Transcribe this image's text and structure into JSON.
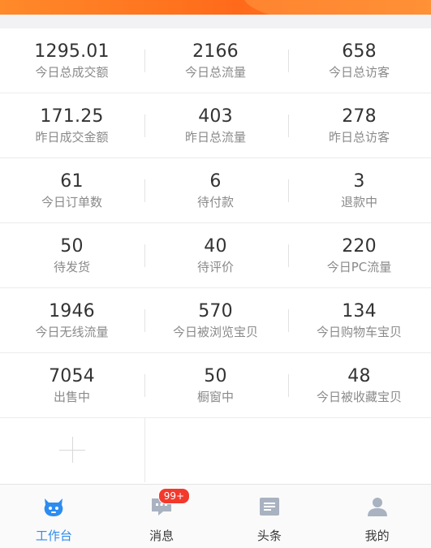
{
  "colors": {
    "banner": "#ff7a22",
    "accent": "#2d8cf0",
    "badge": "#f23a2c",
    "value_text": "#333333",
    "label_text": "#8a8a8a"
  },
  "stats": [
    [
      {
        "value": "1295.01",
        "label": "今日总成交额"
      },
      {
        "value": "2166",
        "label": "今日总流量"
      },
      {
        "value": "658",
        "label": "今日总访客"
      }
    ],
    [
      {
        "value": "171.25",
        "label": "昨日成交金额"
      },
      {
        "value": "403",
        "label": "昨日总流量"
      },
      {
        "value": "278",
        "label": "昨日总访客"
      }
    ],
    [
      {
        "value": "61",
        "label": "今日订单数"
      },
      {
        "value": "6",
        "label": "待付款"
      },
      {
        "value": "3",
        "label": "退款中"
      }
    ],
    [
      {
        "value": "50",
        "label": "待发货"
      },
      {
        "value": "40",
        "label": "待评价"
      },
      {
        "value": "220",
        "label": "今日PC流量"
      }
    ],
    [
      {
        "value": "1946",
        "label": "今日无线流量"
      },
      {
        "value": "570",
        "label": "今日被浏览宝贝"
      },
      {
        "value": "134",
        "label": "今日购物车宝贝"
      }
    ],
    [
      {
        "value": "7054",
        "label": "出售中"
      },
      {
        "value": "50",
        "label": "橱窗中"
      },
      {
        "value": "48",
        "label": "今日被收藏宝贝"
      }
    ]
  ],
  "tabbar": {
    "items": [
      {
        "label": "工作台",
        "icon": "workbench-icon",
        "active": true
      },
      {
        "label": "消息",
        "icon": "message-icon",
        "badge": "99+"
      },
      {
        "label": "头条",
        "icon": "headlines-icon"
      },
      {
        "label": "我的",
        "icon": "profile-icon"
      }
    ]
  }
}
